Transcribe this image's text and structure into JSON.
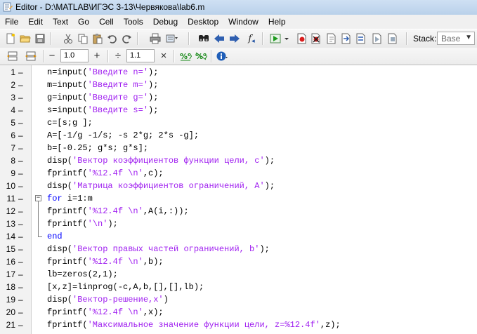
{
  "window": {
    "title": "Editor - D:\\MATLAB\\ИГЭС 3-13\\Червякова\\lab6.m"
  },
  "menu": [
    "File",
    "Edit",
    "Text",
    "Go",
    "Cell",
    "Tools",
    "Debug",
    "Desktop",
    "Window",
    "Help"
  ],
  "toolbar": {
    "stack_label": "Stack:",
    "stack_value": "Base",
    "fx_label": "f"
  },
  "cell_toolbar": {
    "minus": "−",
    "plus": "+",
    "divide": "÷",
    "times": "×",
    "value1": "1.0",
    "value2": "1.1"
  },
  "code_lines": [
    {
      "n": "1",
      "dash": "–",
      "tokens": [
        [
          "n=input(",
          ""
        ],
        [
          "'Введите n='",
          "str"
        ],
        [
          ");",
          ""
        ]
      ]
    },
    {
      "n": "2",
      "dash": "–",
      "tokens": [
        [
          "m=input(",
          ""
        ],
        [
          "'Введите m='",
          "str"
        ],
        [
          ");",
          ""
        ]
      ]
    },
    {
      "n": "3",
      "dash": "–",
      "tokens": [
        [
          "g=input(",
          ""
        ],
        [
          "'Введите g='",
          "str"
        ],
        [
          ");",
          ""
        ]
      ]
    },
    {
      "n": "4",
      "dash": "–",
      "tokens": [
        [
          "s=input(",
          ""
        ],
        [
          "'Введите s='",
          "str"
        ],
        [
          ");",
          ""
        ]
      ]
    },
    {
      "n": "5",
      "dash": "–",
      "tokens": [
        [
          "c=[s;g ];",
          ""
        ]
      ]
    },
    {
      "n": "6",
      "dash": "–",
      "tokens": [
        [
          "A=[-1/g -1/s; -s 2*g; 2*s -g];",
          ""
        ]
      ]
    },
    {
      "n": "7",
      "dash": "–",
      "tokens": [
        [
          "b=[-0.25; g*s; g*s];",
          ""
        ]
      ]
    },
    {
      "n": "8",
      "dash": "–",
      "tokens": [
        [
          "disp(",
          ""
        ],
        [
          "'Вектор коэффициентов функции цели, с'",
          "str"
        ],
        [
          ");",
          ""
        ]
      ]
    },
    {
      "n": "9",
      "dash": "–",
      "tokens": [
        [
          "fprintf(",
          ""
        ],
        [
          "'%12.4f \\n'",
          "str"
        ],
        [
          ",c);",
          ""
        ]
      ]
    },
    {
      "n": "10",
      "dash": "–",
      "tokens": [
        [
          "disp(",
          ""
        ],
        [
          "'Матрица коэффициентов ограничений, А'",
          "str"
        ],
        [
          ");",
          ""
        ]
      ]
    },
    {
      "n": "11",
      "dash": "–",
      "tokens": [
        [
          "for",
          "kw"
        ],
        [
          " i=1:m",
          ""
        ]
      ]
    },
    {
      "n": "12",
      "dash": "–",
      "tokens": [
        [
          "fprintf(",
          ""
        ],
        [
          "'%12.4f \\n'",
          "str"
        ],
        [
          ",A(i,:));",
          ""
        ]
      ]
    },
    {
      "n": "13",
      "dash": "–",
      "tokens": [
        [
          "fprintf(",
          ""
        ],
        [
          "'\\n'",
          "str"
        ],
        [
          ");",
          ""
        ]
      ]
    },
    {
      "n": "14",
      "dash": "–",
      "tokens": [
        [
          "end",
          "kw"
        ]
      ]
    },
    {
      "n": "15",
      "dash": "–",
      "tokens": [
        [
          "disp(",
          ""
        ],
        [
          "'Вектор правых частей ограничений, b'",
          "str"
        ],
        [
          ");",
          ""
        ]
      ]
    },
    {
      "n": "16",
      "dash": "–",
      "tokens": [
        [
          "fprintf(",
          ""
        ],
        [
          "'%12.4f \\n'",
          "str"
        ],
        [
          ",b);",
          ""
        ]
      ]
    },
    {
      "n": "17",
      "dash": "–",
      "tokens": [
        [
          "lb=zeros(2,1);",
          ""
        ]
      ]
    },
    {
      "n": "18",
      "dash": "–",
      "tokens": [
        [
          "[x,z]=linprog(-c,A,b,[],[],lb);",
          ""
        ]
      ]
    },
    {
      "n": "19",
      "dash": "–",
      "tokens": [
        [
          "disp(",
          ""
        ],
        [
          "'Вектор-решение,x'",
          "str"
        ],
        [
          ")",
          ""
        ]
      ]
    },
    {
      "n": "20",
      "dash": "–",
      "tokens": [
        [
          "fprintf(",
          ""
        ],
        [
          "'%12.4f \\n'",
          "str"
        ],
        [
          ",x);",
          ""
        ]
      ]
    },
    {
      "n": "21",
      "dash": "–",
      "tokens": [
        [
          "fprintf(",
          ""
        ],
        [
          "'Максимальное значение функции цели, z=%12.4f'",
          "str"
        ],
        [
          ",z);",
          ""
        ]
      ]
    }
  ],
  "colors": {
    "keyword": "#0000ff",
    "string": "#a020f0"
  },
  "icons": {
    "toolbar1": [
      "new-file-icon",
      "open-folder-icon",
      "save-icon",
      "cut-icon",
      "copy-icon",
      "paste-icon",
      "undo-icon",
      "redo-icon",
      "print-icon",
      "print-preview-icon",
      "find-icon",
      "back-icon",
      "forward-icon",
      "function-icon",
      "run-icon",
      "breakpoint-set-icon",
      "breakpoint-clear-icon",
      "step-icon",
      "step-in-icon",
      "step-out-icon",
      "continue-icon",
      "exit-debug-icon"
    ],
    "toolbar2": [
      "insert-cell-icon",
      "run-cell-icon",
      "cell-help-icon"
    ]
  }
}
